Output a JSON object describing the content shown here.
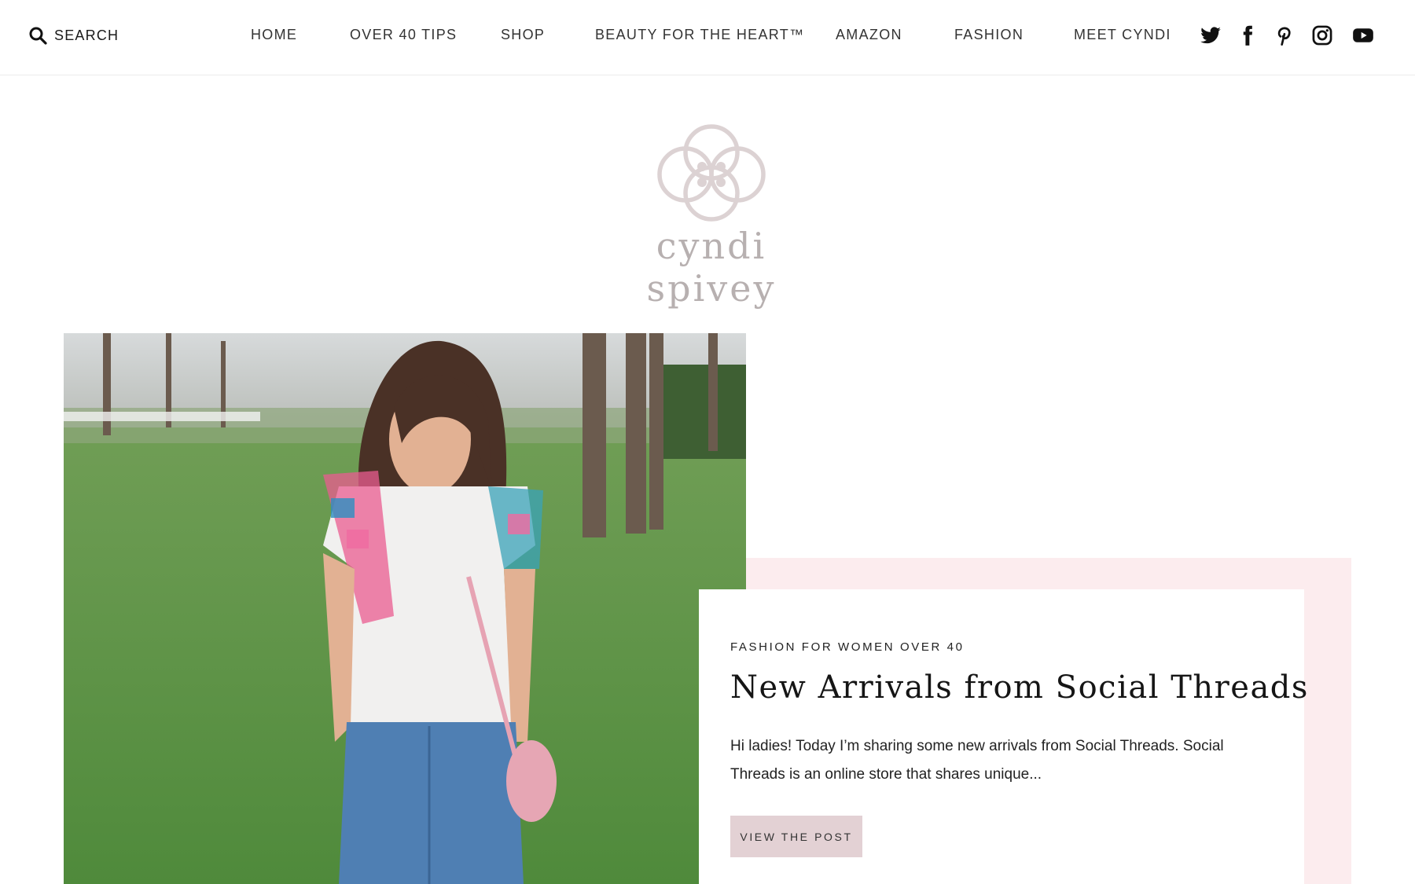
{
  "header": {
    "search_label": "SEARCH",
    "nav": [
      {
        "label": "HOME"
      },
      {
        "label": "OVER 40 TIPS"
      },
      {
        "label": "SHOP"
      },
      {
        "label": "BEAUTY FOR THE HEART™"
      },
      {
        "label": "AMAZON"
      },
      {
        "label": "FASHION"
      },
      {
        "label": "MEET CYNDI"
      }
    ],
    "social_icons": [
      "twitter-icon",
      "facebook-icon",
      "pinterest-icon",
      "instagram-icon",
      "youtube-icon"
    ]
  },
  "logo": {
    "text": "cyndi spivey",
    "color": "#b7b0b0"
  },
  "featured_post": {
    "category": "FASHION FOR WOMEN OVER 40",
    "title": "New Arrivals from Social Threads",
    "excerpt": "Hi ladies! Today I’m sharing some new arrivals from Social Threads. Social Threads is an online store that shares unique...",
    "button_label": "VIEW THE POST"
  },
  "colors": {
    "accent_pink": "#fcecee",
    "button_bg": "#e3d1d4",
    "text": "#1a1a1a"
  }
}
